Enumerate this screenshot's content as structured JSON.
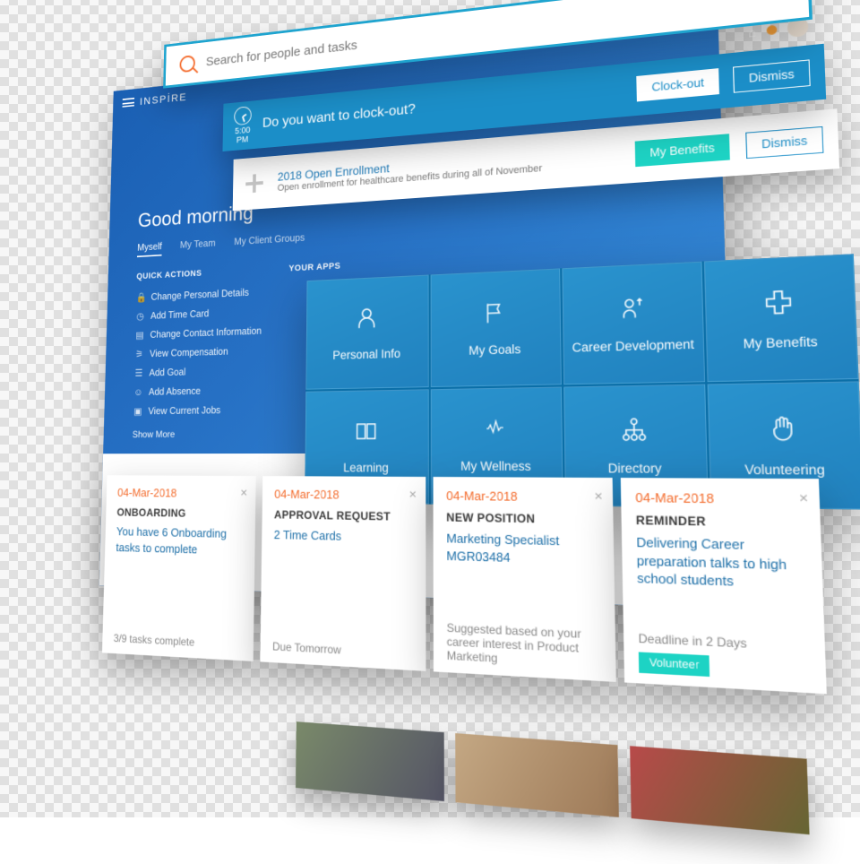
{
  "brand": "iNSPİRE",
  "search": {
    "placeholder": "Search for people and tasks"
  },
  "header_icons": {
    "home": "home",
    "bell": "notifications",
    "avatar": "avatar"
  },
  "clock_banner": {
    "time": "5:00",
    "period": "PM",
    "message": "Do you want to clock-out?",
    "primary_btn": "Clock-out",
    "dismiss_btn": "Dismiss"
  },
  "enroll_banner": {
    "title": "2018 Open Enrollment",
    "subtitle": "Open enrollment for healthcare benefits during all of November",
    "primary_btn": "My Benefits",
    "dismiss_btn": "Dismiss"
  },
  "greeting": "Good morning",
  "tabs": [
    "Myself",
    "My Team",
    "My Client Groups"
  ],
  "section_quick": "QUICK ACTIONS",
  "section_apps": "YOUR APPS",
  "quick_actions": [
    "Change Personal Details",
    "Add Time Card",
    "Change Contact Information",
    "View Compensation",
    "Add Goal",
    "Add Absence",
    "View Current Jobs"
  ],
  "show_more": "Show More",
  "tiles": [
    "Personal Info",
    "My Goals",
    "Career Development",
    "My Benefits",
    "Learning",
    "My Wellness",
    "Directory",
    "Volunteering"
  ],
  "cards": [
    {
      "date": "04-Mar-2018",
      "title": "ONBOARDING",
      "body": "You have 6 Onboarding tasks to complete",
      "foot": "3/9 tasks complete"
    },
    {
      "date": "04-Mar-2018",
      "title": "APPROVAL REQUEST",
      "body": "2 Time Cards",
      "foot": "Due Tomorrow"
    },
    {
      "date": "04-Mar-2018",
      "title": "NEW POSITION",
      "body": "Marketing Specialist MGR03484",
      "foot": "Suggested based on your career interest in Product Marketing"
    },
    {
      "date": "04-Mar-2018",
      "title": "REMINDER",
      "body": "Delivering Career preparation talks to high school students",
      "foot": "Deadline in 2 Days",
      "action": "Volunteer"
    }
  ]
}
